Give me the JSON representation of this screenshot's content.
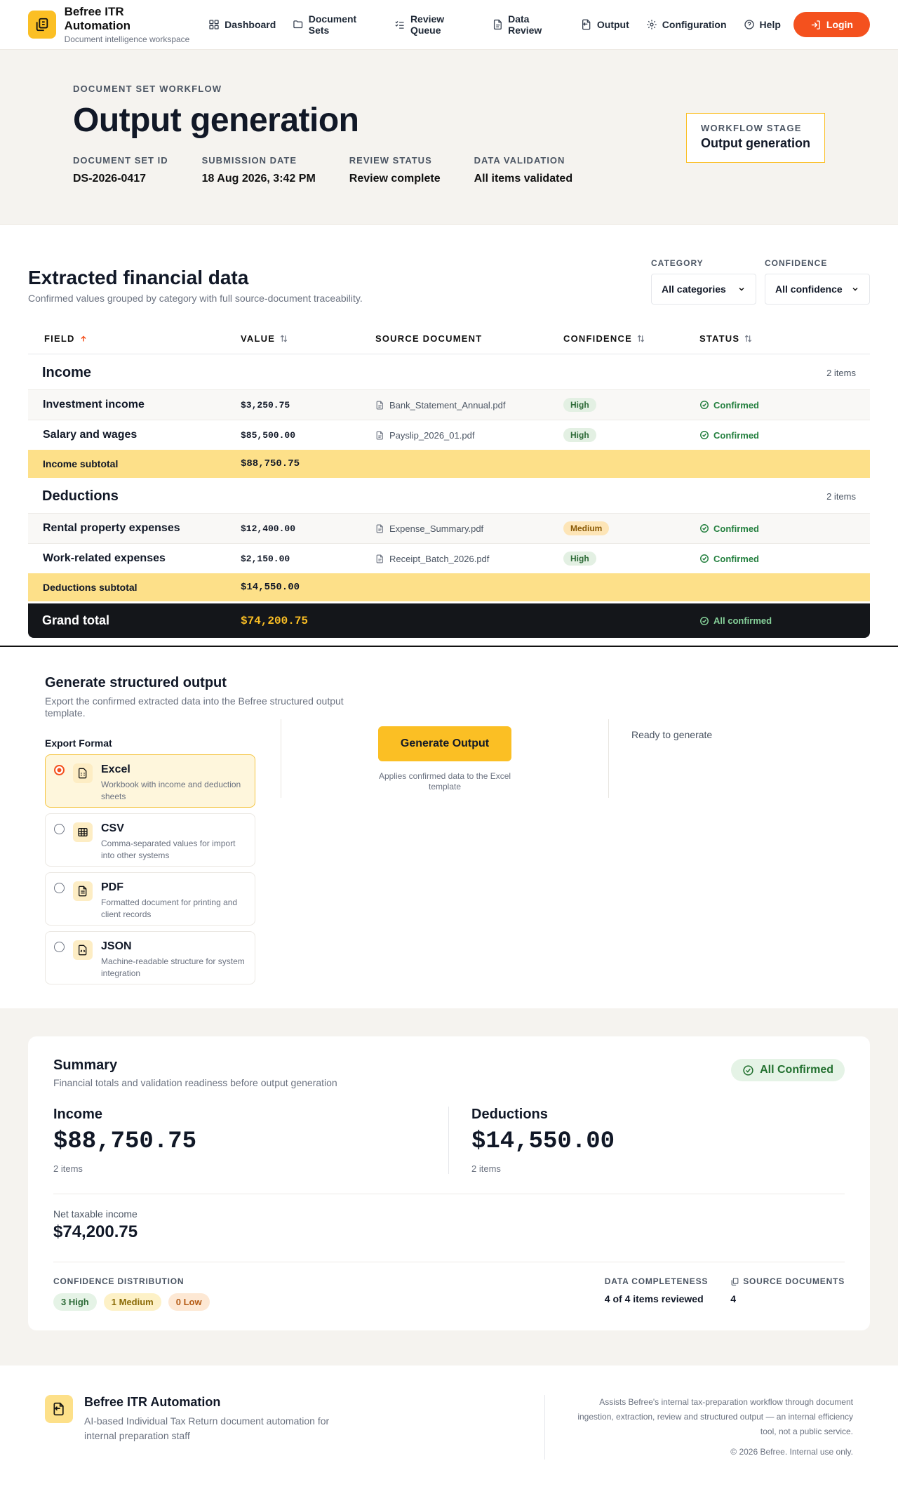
{
  "app": {
    "name": "Befree ITR Automation",
    "tagline": "Document intelligence workspace"
  },
  "nav": {
    "items": [
      {
        "label": "Dashboard",
        "icon": "grid-icon"
      },
      {
        "label": "Document Sets",
        "icon": "folder-icon"
      },
      {
        "label": "Review Queue",
        "icon": "checklist-icon"
      },
      {
        "label": "Data Review",
        "icon": "document-icon"
      },
      {
        "label": "Output",
        "icon": "file-export-icon"
      },
      {
        "label": "Configuration",
        "icon": "gear-icon"
      },
      {
        "label": "Help",
        "icon": "help-icon"
      }
    ],
    "login_label": "Login"
  },
  "hero": {
    "eyebrow": "DOCUMENT SET WORKFLOW",
    "title": "Output generation",
    "meta": [
      {
        "label": "DOCUMENT SET ID",
        "value": "DS-2026-0417"
      },
      {
        "label": "SUBMISSION DATE",
        "value": "18 Aug 2026, 3:42 PM"
      },
      {
        "label": "REVIEW STATUS",
        "value": "Review complete"
      },
      {
        "label": "DATA VALIDATION",
        "value": "All items validated"
      }
    ],
    "stage_label": "WORKFLOW STAGE",
    "stage_value": "Output generation"
  },
  "extracted": {
    "title": "Extracted financial data",
    "subtitle": "Confirmed values grouped by category with full source-document traceability.",
    "filters": {
      "category_label": "CATEGORY",
      "category_value": "All categories",
      "confidence_label": "CONFIDENCE",
      "confidence_value": "All confidence"
    },
    "columns": [
      "FIELD",
      "VALUE",
      "SOURCE DOCUMENT",
      "CONFIDENCE",
      "STATUS"
    ],
    "groups": [
      {
        "title": "Income",
        "count": "2 items",
        "rows": [
          {
            "field": "Investment income",
            "value": "$3,250.75",
            "source": "Bank_Statement_Annual.pdf",
            "confidence": "High",
            "status": "Confirmed"
          },
          {
            "field": "Salary and wages",
            "value": "$85,500.00",
            "source": "Payslip_2026_01.pdf",
            "confidence": "High",
            "status": "Confirmed"
          }
        ],
        "subtotal_label": "Income subtotal",
        "subtotal_value": "$88,750.75"
      },
      {
        "title": "Deductions",
        "count": "2 items",
        "rows": [
          {
            "field": "Rental property expenses",
            "value": "$12,400.00",
            "source": "Expense_Summary.pdf",
            "confidence": "Medium",
            "status": "Confirmed"
          },
          {
            "field": "Work-related expenses",
            "value": "$2,150.00",
            "source": "Receipt_Batch_2026.pdf",
            "confidence": "High",
            "status": "Confirmed"
          }
        ],
        "subtotal_label": "Deductions subtotal",
        "subtotal_value": "$14,550.00"
      }
    ],
    "grand_label": "Grand total",
    "grand_value": "$74,200.75",
    "grand_status": "All confirmed"
  },
  "generate": {
    "title": "Generate structured output",
    "description": "Export the confirmed extracted data into the Befree structured output template.",
    "format_label": "Export Format",
    "formats": [
      {
        "name": "Excel",
        "desc": "Workbook with income and deduction sheets",
        "selected": true,
        "icon": "spreadsheet-icon"
      },
      {
        "name": "CSV",
        "desc": "Comma-separated values for import into other systems",
        "selected": false,
        "icon": "table-icon"
      },
      {
        "name": "PDF",
        "desc": "Formatted document for printing and client records",
        "selected": false,
        "icon": "pdf-icon"
      },
      {
        "name": "JSON",
        "desc": "Machine-readable structure for system integration",
        "selected": false,
        "icon": "code-file-icon"
      }
    ],
    "button_label": "Generate Output",
    "hint": "Applies confirmed data to the Excel template",
    "status": "Ready to generate"
  },
  "summary": {
    "title": "Summary",
    "subtitle": "Financial totals and validation readiness before output generation",
    "badge": "All Confirmed",
    "income_label": "Income",
    "income_value": "$88,750.75",
    "income_count": "2 items",
    "deductions_label": "Deductions",
    "deductions_value": "$14,550.00",
    "deductions_count": "2 items",
    "net_label": "Net taxable income",
    "net_value": "$74,200.75",
    "dist_label": "CONFIDENCE DISTRIBUTION",
    "dist": {
      "high_count": "3",
      "high_label": "High",
      "medium_count": "1",
      "medium_label": "Medium",
      "low_count": "0",
      "low_label": "Low"
    },
    "completeness_label": "DATA COMPLETENESS",
    "completeness_value": "4 of 4 items reviewed",
    "sources_label": "SOURCE DOCUMENTS",
    "sources_value": "4"
  },
  "footer": {
    "title": "Befree ITR Automation",
    "subtitle": "AI-based Individual Tax Return document automation for internal preparation staff",
    "about": "Assists Befree's internal tax-preparation workflow through document ingestion, extraction, review and structured output — an internal efficiency tool, not a public service.",
    "copyright": "© 2026 Befree. Internal use only."
  },
  "colors": {
    "accent": "#fbbf24",
    "login": "#f4511e",
    "confirmed": "#24803f",
    "subtotal_bg": "#fde089",
    "grand_bg": "#14161a"
  }
}
